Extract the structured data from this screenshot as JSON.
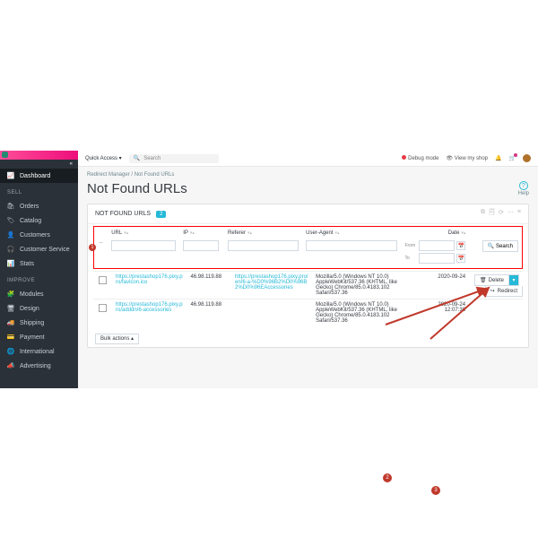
{
  "sidebar": {
    "dashboard": "Dashboard",
    "headings": {
      "sell": "SELL",
      "improve": "IMPROVE"
    },
    "sell": [
      "Orders",
      "Catalog",
      "Customers",
      "Customer Service",
      "Stats"
    ],
    "improve": [
      "Modules",
      "Design",
      "Shipping",
      "Payment",
      "International",
      "Advertising"
    ]
  },
  "topbar": {
    "quick_access": "Quick Access",
    "search_placeholder": "Search",
    "debug": "Debug mode",
    "view_shop": "View my shop"
  },
  "breadcrumb": {
    "parent": "Redirect Manager",
    "current": "Not Found URLs"
  },
  "page": {
    "title": "Not Found URLs",
    "help": "Help"
  },
  "panel": {
    "title": "NOT FOUND URLS",
    "count": "2"
  },
  "table": {
    "columns": [
      "URL",
      "IP",
      "Referer",
      "User-Agent",
      "Date"
    ],
    "date_from": "From",
    "date_to": "To",
    "search_btn": "Search",
    "bulk": "Bulk actions",
    "actions": {
      "delete": "Delete",
      "redirect": "Redirect"
    },
    "rows": [
      {
        "url": "https://prestashop176.pixy.pro/favicon.ico",
        "ip": "46.98.119.88",
        "referer": "https://prestashop176.pixy.pro/en/6-a-%D0%96B2%D0%96B2%D0%96EAccessories",
        "user_agent": "Mozilla/5.0 (Windows NT 10.0) AppleWebKit/537.36 (KHTML, like Gecko) Chrome/85.0.4183.102 Safari/537.36",
        "date": "2020-09-24"
      },
      {
        "url": "https://prestashop176.pixy.pro/adddn/6-accessories",
        "ip": "46.98.119.88",
        "referer": "",
        "user_agent": "Mozilla/5.0 (Windows NT 10.0) AppleWebKit/537.36 (KHTML, like Gecko) Chrome/85.0.4183.102 Safari/537.36",
        "date": "2020-09-24 12:07:36"
      }
    ]
  },
  "annotations": [
    "1",
    "2",
    "3"
  ]
}
